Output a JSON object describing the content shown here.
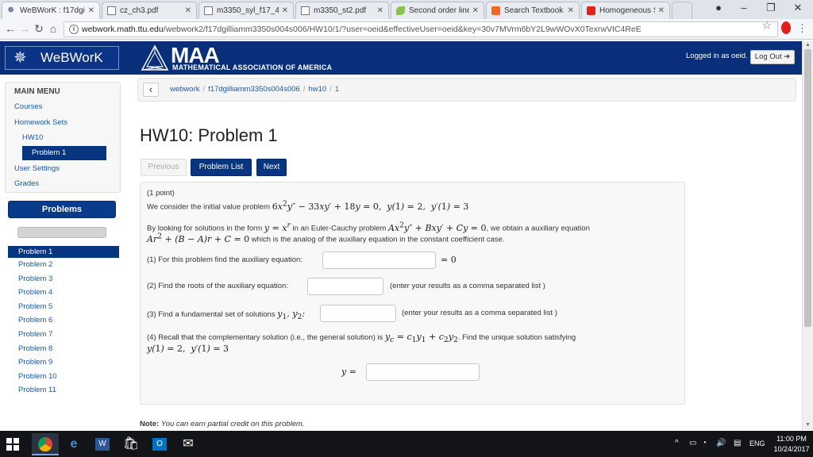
{
  "browser": {
    "tabs": [
      {
        "title": "WeBWorK : f17dgi",
        "icon": "webwork-icon"
      },
      {
        "title": "cz_ch3.pdf",
        "icon": "document-icon"
      },
      {
        "title": "m3350_syl_f17_4.p",
        "icon": "document-icon"
      },
      {
        "title": "m3350_st2.pdf",
        "icon": "document-icon"
      },
      {
        "title": "Second order linea",
        "icon": "leaf-icon"
      },
      {
        "title": "Search Textbook S",
        "icon": "chegg-icon"
      },
      {
        "title": "Homogeneous Se",
        "icon": "youtube-icon"
      }
    ],
    "url_host": "webwork.math.ttu.edu",
    "url_path": "/webwork2/f17dgilliamm3350s004s006/HW10/1/?user=oeid&effectiveUser=oeid&key=30v7MVrm6bY2L9wWOvX0TexrwVIC4ReE"
  },
  "header": {
    "logo_text": "WeBWorK",
    "maa_big": "MAA",
    "maa_sub": "MATHEMATICAL ASSOCIATION OF AMERICA",
    "logged_in": "Logged in as oeid.",
    "logout_label": "Log Out"
  },
  "sidebar": {
    "menu_title": "MAIN MENU",
    "items": [
      "Courses",
      "Homework Sets",
      "HW10",
      "Problem 1",
      "User Settings",
      "Grades"
    ],
    "problems_title": "Problems",
    "problems": [
      "Problem 1",
      "Problem 2",
      "Problem 3",
      "Problem 4",
      "Problem 5",
      "Problem 6",
      "Problem 7",
      "Problem 8",
      "Problem 9",
      "Problem 10",
      "Problem 11"
    ]
  },
  "breadcrumb": {
    "root": "webwork",
    "course": "f17dgilliamm3350s004s006",
    "set": "hw10",
    "current": "1"
  },
  "main": {
    "title": "HW10: Problem 1",
    "prev_label": "Previous",
    "list_label": "Problem List",
    "next_label": "Next",
    "points": "(1 point)",
    "intro": "We consider the initial value problem",
    "euler_a": "By looking for solutions in the form",
    "euler_b": "in an Euler-Cauchy problem",
    "euler_c": ", we obtain a auxiliary equation",
    "analog": "which is the analog of the auxiliary equation in the constant coefficient case.",
    "q1": "(1) For this problem find the auxiliary equation:",
    "q1_suffix": "= 0",
    "q2": "(2) Find the roots of the auxiliary equation:",
    "q2_hint": "(enter your results as a comma separated list )",
    "q3": "(3) Find a fundamental set of solutions",
    "q3_hint": "(enter your results as a comma separated list )",
    "q4_a": "(4) Recall that the complementary solution (i.e., the general solution) is",
    "q4_b": ". Find the unique solution satisfying",
    "y_label": "y =",
    "note_label": "Note:",
    "note_text": "You can earn partial credit on this problem."
  },
  "taskbar": {
    "lang": "ENG",
    "time": "11:00 PM",
    "date": "10/24/2017"
  }
}
